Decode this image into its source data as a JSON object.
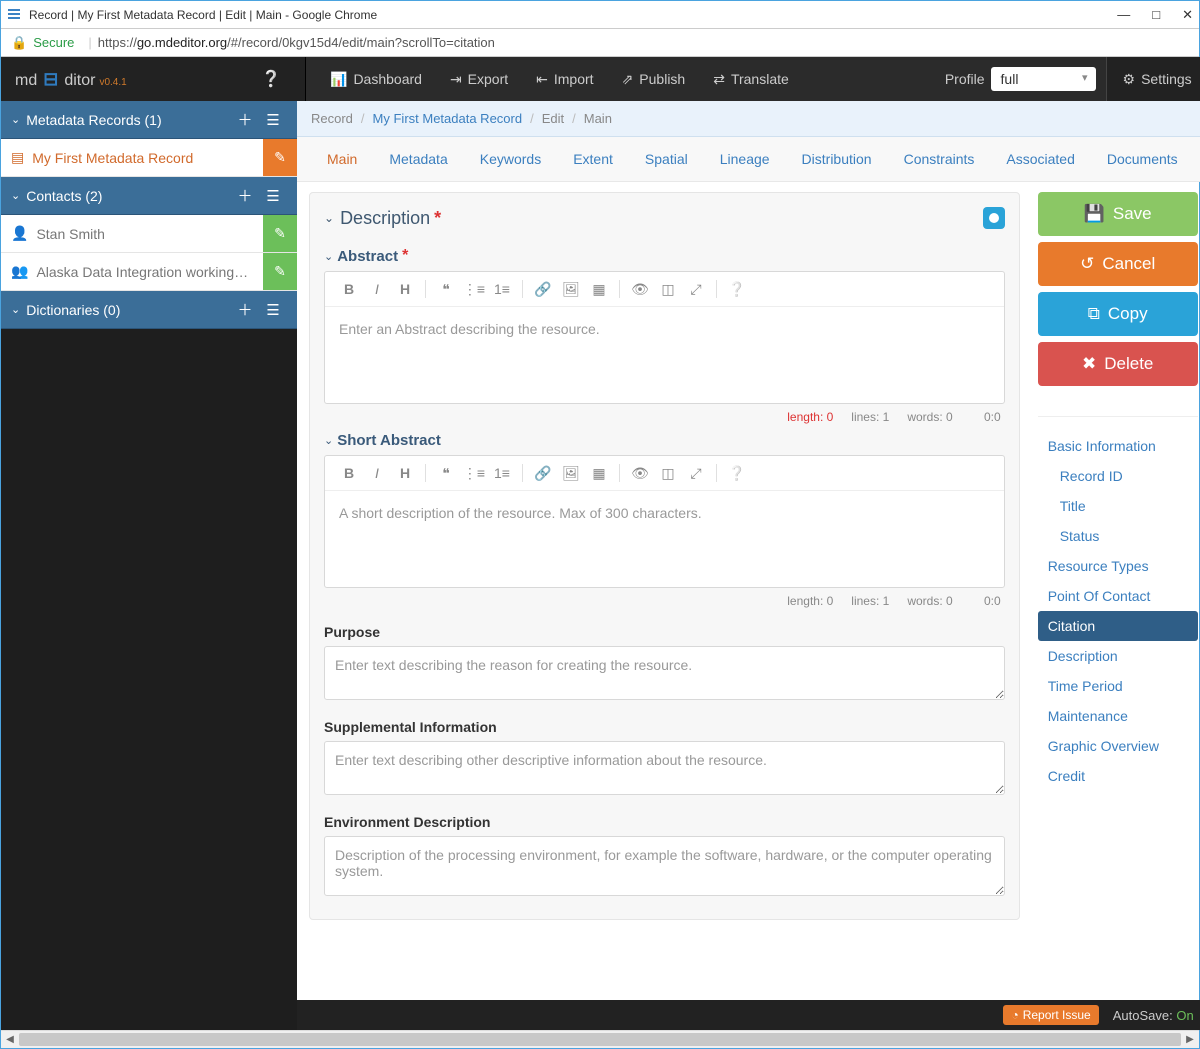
{
  "window": {
    "title": "Record | My First Metadata Record | Edit | Main - Google Chrome",
    "secure_label": "Secure",
    "url_prefix": "https://",
    "url_host": "go.mdeditor.org",
    "url_path": "/#/record/0kgv15d4/edit/main?scrollTo=citation"
  },
  "brand": {
    "left": "md",
    "right": "ditor",
    "version": "v0.4.1"
  },
  "topnav": {
    "dashboard": "Dashboard",
    "export": "Export",
    "import": "Import",
    "publish": "Publish",
    "translate": "Translate",
    "profile_label": "Profile",
    "profile_value": "full",
    "settings": "Settings"
  },
  "sidebar": {
    "records_hdr": "Metadata Records (1)",
    "records": [
      "My First Metadata Record"
    ],
    "contacts_hdr": "Contacts (2)",
    "contacts": [
      "Stan Smith",
      "Alaska Data Integration working…"
    ],
    "dict_hdr": "Dictionaries (0)"
  },
  "breadcrumb": {
    "a": "Record",
    "b": "My First Metadata Record",
    "c": "Edit",
    "d": "Main"
  },
  "tabs": [
    "Main",
    "Metadata",
    "Keywords",
    "Extent",
    "Spatial",
    "Lineage",
    "Distribution",
    "Constraints",
    "Associated",
    "Documents"
  ],
  "panel": {
    "title": "Description"
  },
  "abstract": {
    "label": "Abstract",
    "placeholder": "Enter an Abstract describing the resource.",
    "length": "length: 0",
    "lines": "lines: 1",
    "words": "words: 0",
    "time": "0:0"
  },
  "short": {
    "label": "Short Abstract",
    "placeholder": "A short description of the resource. Max of 300 characters.",
    "length": "length: 0",
    "lines": "lines: 1",
    "words": "words: 0",
    "time": "0:0"
  },
  "purpose": {
    "label": "Purpose",
    "placeholder": "Enter text describing the reason for creating the resource."
  },
  "supp": {
    "label": "Supplemental Information",
    "placeholder": "Enter text describing other descriptive information about the resource."
  },
  "env": {
    "label": "Environment Description",
    "placeholder": "Description of the processing environment, for example the software, hardware, or the computer operating system."
  },
  "actions": {
    "save": "Save",
    "cancel": "Cancel",
    "copy": "Copy",
    "delete": "Delete"
  },
  "rightnav": {
    "items": [
      {
        "label": "Basic Information",
        "sub": false,
        "active": false
      },
      {
        "label": "Record ID",
        "sub": true,
        "active": false
      },
      {
        "label": "Title",
        "sub": true,
        "active": false
      },
      {
        "label": "Status",
        "sub": true,
        "active": false
      },
      {
        "label": "Resource Types",
        "sub": false,
        "active": false
      },
      {
        "label": "Point Of Contact",
        "sub": false,
        "active": false
      },
      {
        "label": "Citation",
        "sub": false,
        "active": true
      },
      {
        "label": "Description",
        "sub": false,
        "active": false
      },
      {
        "label": "Time Period",
        "sub": false,
        "active": false
      },
      {
        "label": "Maintenance",
        "sub": false,
        "active": false
      },
      {
        "label": "Graphic Overview",
        "sub": false,
        "active": false
      },
      {
        "label": "Credit",
        "sub": false,
        "active": false
      }
    ]
  },
  "footer": {
    "report": "Report Issue",
    "autosave_label": "AutoSave: ",
    "autosave_state": "On"
  }
}
